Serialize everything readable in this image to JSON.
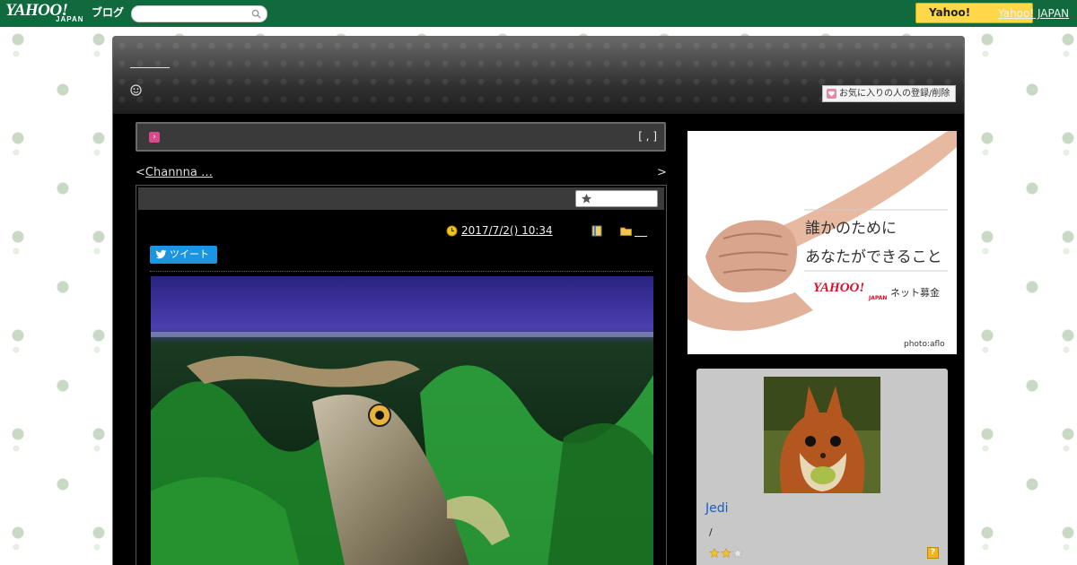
{
  "topbar": {
    "logo_text": "YAHOO!",
    "logo_sub": "JAPAN",
    "service_label": "ブログ",
    "search_placeholder": "",
    "yahoo_button_label": "Yahoo!",
    "yahoo_japan_link": "Yahoo! JAPAN"
  },
  "header": {
    "favorite_register_label": "お気に入りの人の登録/削除"
  },
  "main": {
    "crumb_bracket": "[ , ]",
    "prev_prefix": "<",
    "prev_label": "Channna …",
    "next_label": ">",
    "date_label": "2017/7/2()  10:34",
    "tweet_label": "ツイート"
  },
  "ad": {
    "line1": "誰かのために",
    "line2": "あなたができること",
    "brand": "YAHOO!",
    "brand_sub": "JAPAN",
    "service": "ネット募金",
    "credit": "photo:aflo"
  },
  "profile": {
    "name": "Jedi",
    "sub": "/",
    "star_rating": 2,
    "star_max": 3,
    "help_label": "?"
  },
  "colors": {
    "topbar": "#106a3e",
    "link_blue": "#1a5ebe",
    "tweet_blue": "#1b95e0",
    "yahoo_button": "#ffd84a"
  }
}
